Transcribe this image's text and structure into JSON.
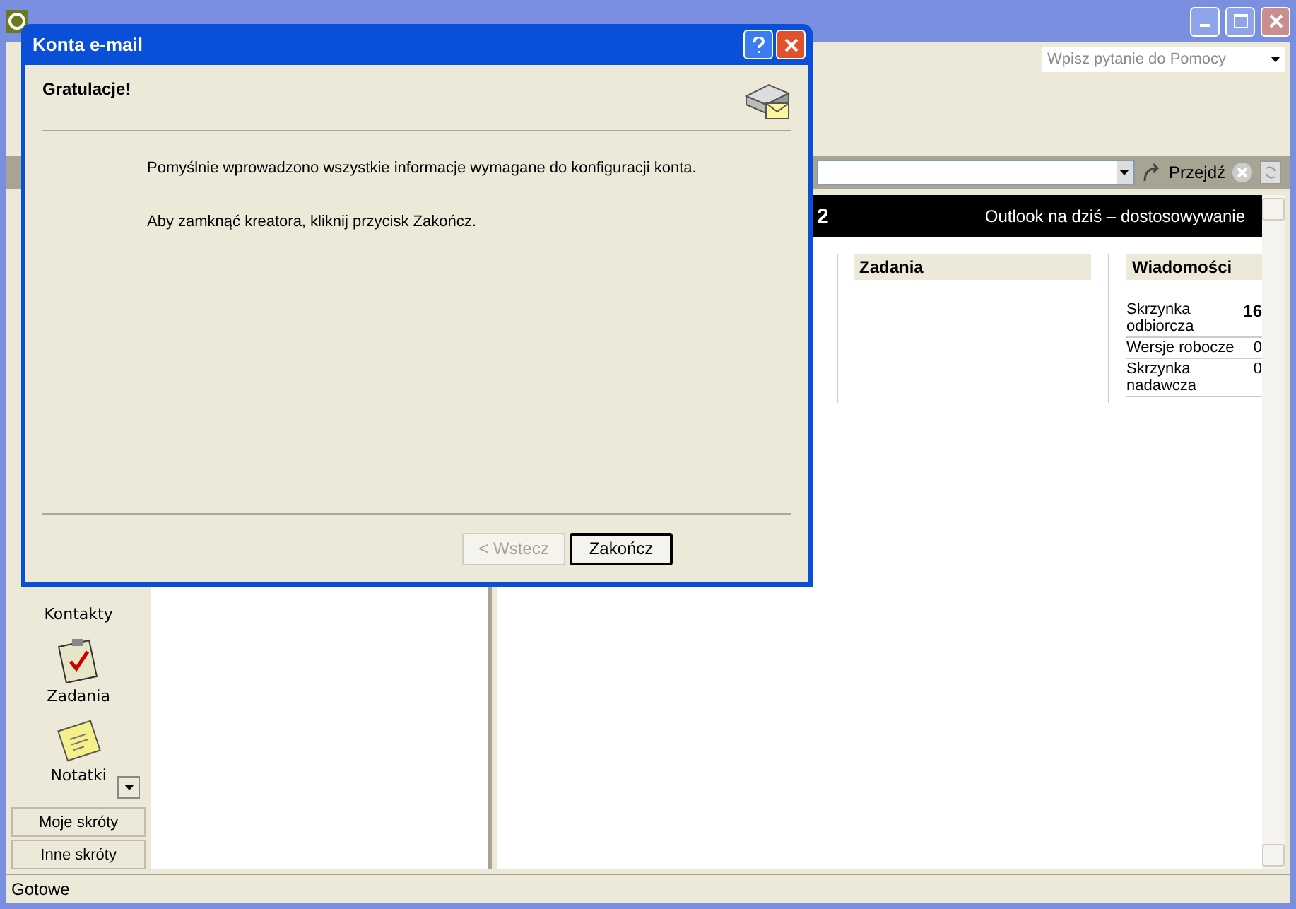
{
  "help_box": {
    "placeholder": "Wpisz pytanie do Pomocy"
  },
  "address_bar": {
    "go_button": "Przejdź"
  },
  "navigation_pane": {
    "items": [
      {
        "label": "Kontakty",
        "kind": "contacts"
      },
      {
        "label": "Zadania",
        "kind": "tasks"
      },
      {
        "label": "Notatki",
        "kind": "notes"
      }
    ],
    "shortcut_buttons": [
      "Moje skróty",
      "Inne skróty"
    ]
  },
  "today_header": {
    "title_fragment": "2",
    "customize_link": "Outlook na dziś – dostosowywanie"
  },
  "tasks_section": {
    "title": "Zadania"
  },
  "messages_section": {
    "title": "Wiadomości",
    "rows": [
      {
        "name": "Skrzynka odbiorcza",
        "count": "16",
        "unread": true
      },
      {
        "name": "Wersje robocze",
        "count": "0",
        "unread": false
      },
      {
        "name": "Skrzynka nadawcza",
        "count": "0",
        "unread": false
      }
    ]
  },
  "status_bar": "Gotowe",
  "dialog": {
    "title": "Konta e-mail",
    "heading": "Gratulacje!",
    "paragraphs": [
      "Pomyślnie wprowadzono wszystkie informacje wymagane do konfiguracji konta.",
      "Aby zamknąć kreatora, kliknij przycisk Zakończ."
    ],
    "buttons": [
      {
        "label": "< Wstecz",
        "disabled": true
      },
      {
        "label": "Zakończ",
        "disabled": false
      }
    ]
  }
}
